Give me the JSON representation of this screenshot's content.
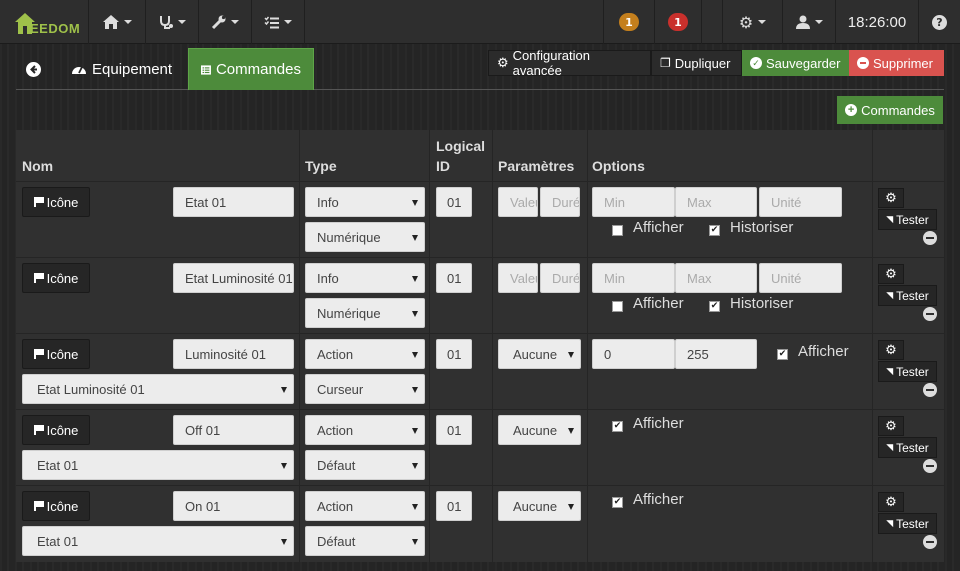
{
  "navbar": {
    "logo_text": "EEDOM",
    "home_icon": "home-icon",
    "health_icon": "stethoscope-icon",
    "tools_icon": "wrench-icon",
    "scenario_icon": "list-check-icon",
    "badge_orange": "1",
    "badge_red": "1",
    "badge_orange_color": "#c47f1d",
    "badge_red_color": "#c9302c",
    "settings_icon": "gears-icon",
    "user_icon": "user-icon",
    "time": "18:26:00",
    "help_label": "?"
  },
  "tabs": {
    "back_icon": "arrow-left-icon",
    "equipement": "Equipement",
    "commandes": "Commandes"
  },
  "toolbar": {
    "config": "Configuration avancée",
    "dupliquer": "Dupliquer",
    "sauvegarder": "Sauvegarder",
    "supprimer": "Supprimer",
    "add_commandes": "Commandes"
  },
  "colors": {
    "green": "#4d8b3b",
    "red": "#d9534f",
    "dark": "#2e2e2e"
  },
  "table": {
    "headers": {
      "nom": "Nom",
      "type": "Type",
      "logical": "Logical",
      "id": "ID",
      "parametres": "Paramètres",
      "options": "Options"
    },
    "icone_label": "Icône",
    "tester_label": "Tester",
    "afficher": "Afficher",
    "historiser": "Historiser",
    "rows": [
      {
        "name": "Etat 01",
        "type": "Info",
        "subtype": "Numérique",
        "logical_id": "01",
        "val_ph": "Valeur",
        "dur_ph": "Durée",
        "min_ph": "Min",
        "max_ph": "Max",
        "unit_ph": "Unité"
      },
      {
        "name": "Etat Luminosité 01",
        "type": "Info",
        "subtype": "Numérique",
        "logical_id": "01",
        "val_ph": "Valeur",
        "dur_ph": "Durée",
        "min_ph": "Min",
        "max_ph": "Max",
        "unit_ph": "Unité"
      },
      {
        "name": "Luminosité 01",
        "type": "Action",
        "subtype": "Curseur",
        "logical_id": "01",
        "value_select": "Etat Luminosité 01",
        "param": "Aucune",
        "min": "0",
        "max": "255"
      },
      {
        "name": "Off 01",
        "type": "Action",
        "subtype": "Défaut",
        "logical_id": "01",
        "value_select": "Etat 01",
        "param": "Aucune"
      },
      {
        "name": "On 01",
        "type": "Action",
        "subtype": "Défaut",
        "logical_id": "01",
        "value_select": "Etat 01",
        "param": "Aucune"
      }
    ]
  }
}
